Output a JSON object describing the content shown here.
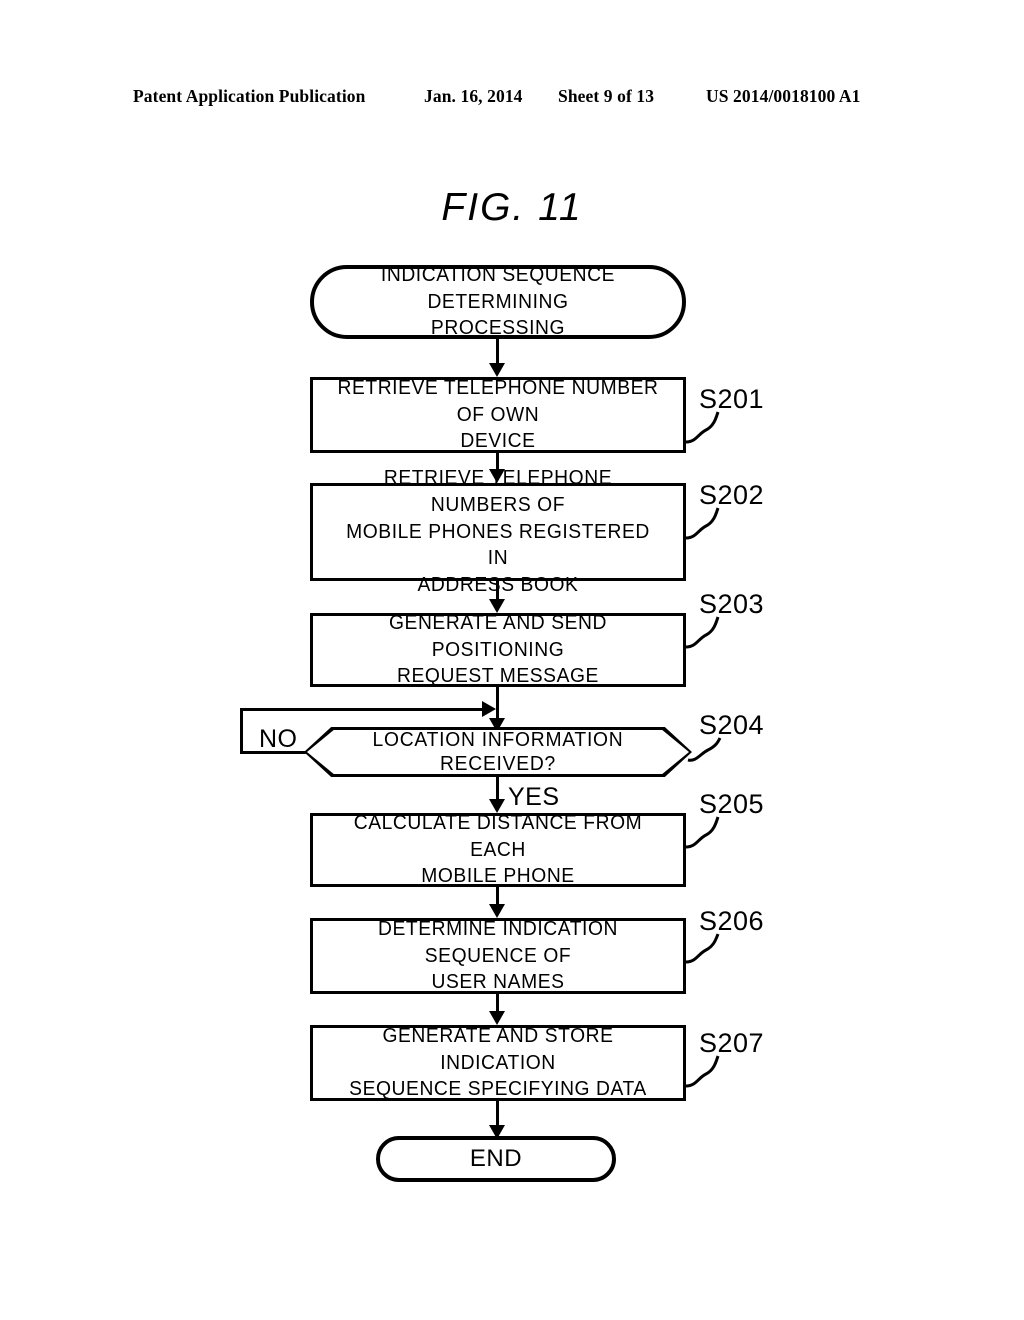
{
  "header": {
    "publication": "Patent Application Publication",
    "date": "Jan. 16, 2014",
    "sheet": "Sheet 9 of 13",
    "patent_number": "US 2014/0018100 A1"
  },
  "figure": {
    "title": "FIG. 11"
  },
  "chart_data": {
    "type": "diagram",
    "diagram_kind": "flowchart",
    "title": "FIG. 11",
    "nodes": [
      {
        "id": "start",
        "shape": "terminator",
        "text": "INDICATION SEQUENCE DETERMINING PROCESSING",
        "lines": [
          "INDICATION SEQUENCE DETERMINING",
          "PROCESSING"
        ],
        "step": ""
      },
      {
        "id": "s201",
        "shape": "process",
        "text": "RETRIEVE TELEPHONE NUMBER OF OWN DEVICE",
        "lines": [
          "RETRIEVE TELEPHONE NUMBER OF OWN",
          "DEVICE"
        ],
        "step": "S201"
      },
      {
        "id": "s202",
        "shape": "process",
        "text": "RETRIEVE TELEPHONE NUMBERS OF MOBILE PHONES REGISTERED IN ADDRESS BOOK",
        "lines": [
          "RETRIEVE TELEPHONE NUMBERS OF",
          "MOBILE PHONES REGISTERED IN",
          "ADDRESS BOOK"
        ],
        "step": "S202"
      },
      {
        "id": "s203",
        "shape": "process",
        "text": "GENERATE AND SEND POSITIONING REQUEST MESSAGE",
        "lines": [
          "GENERATE AND SEND POSITIONING",
          "REQUEST MESSAGE"
        ],
        "step": "S203"
      },
      {
        "id": "s204",
        "shape": "decision",
        "text": "LOCATION INFORMATION RECEIVED?",
        "lines": [
          "LOCATION INFORMATION RECEIVED?"
        ],
        "step": "S204",
        "branches": [
          "NO",
          "YES"
        ]
      },
      {
        "id": "s205",
        "shape": "process",
        "text": "CALCULATE DISTANCE FROM EACH MOBILE PHONE",
        "lines": [
          "CALCULATE DISTANCE FROM EACH",
          "MOBILE PHONE"
        ],
        "step": "S205"
      },
      {
        "id": "s206",
        "shape": "process",
        "text": "DETERMINE INDICATION SEQUENCE OF USER NAMES",
        "lines": [
          "DETERMINE INDICATION SEQUENCE OF",
          "USER NAMES"
        ],
        "step": "S206"
      },
      {
        "id": "s207",
        "shape": "process",
        "text": "GENERATE AND STORE INDICATION SEQUENCE SPECIFYING DATA",
        "lines": [
          "GENERATE AND STORE INDICATION",
          "SEQUENCE SPECIFYING DATA"
        ],
        "step": "S207"
      },
      {
        "id": "end",
        "shape": "terminator",
        "text": "END",
        "lines": [
          "END"
        ],
        "step": ""
      }
    ],
    "edges": [
      {
        "from": "start",
        "to": "s201",
        "label": ""
      },
      {
        "from": "s201",
        "to": "s202",
        "label": ""
      },
      {
        "from": "s202",
        "to": "s203",
        "label": ""
      },
      {
        "from": "s203",
        "to": "s204",
        "label": ""
      },
      {
        "from": "s204",
        "to": "s205",
        "label": "YES"
      },
      {
        "from": "s204",
        "to": "s204",
        "label": "NO"
      },
      {
        "from": "s205",
        "to": "s206",
        "label": ""
      },
      {
        "from": "s206",
        "to": "s207",
        "label": ""
      },
      {
        "from": "s207",
        "to": "end",
        "label": ""
      }
    ]
  },
  "nodes": {
    "start": {
      "line1": "INDICATION SEQUENCE DETERMINING",
      "line2": "PROCESSING"
    },
    "s201": {
      "line1": "RETRIEVE TELEPHONE NUMBER OF OWN",
      "line2": "DEVICE",
      "step": "S201"
    },
    "s202": {
      "line1": "RETRIEVE TELEPHONE NUMBERS OF",
      "line2": "MOBILE PHONES REGISTERED IN",
      "line3": "ADDRESS BOOK",
      "step": "S202"
    },
    "s203": {
      "line1": "GENERATE AND SEND POSITIONING",
      "line2": "REQUEST MESSAGE",
      "step": "S203"
    },
    "s204": {
      "line1": "LOCATION INFORMATION RECEIVED?",
      "step": "S204",
      "no_label": "NO",
      "yes_label": "YES"
    },
    "s205": {
      "line1": "CALCULATE DISTANCE FROM EACH",
      "line2": "MOBILE PHONE",
      "step": "S205"
    },
    "s206": {
      "line1": "DETERMINE INDICATION SEQUENCE OF",
      "line2": "USER NAMES",
      "step": "S206"
    },
    "s207": {
      "line1": "GENERATE AND STORE INDICATION",
      "line2": "SEQUENCE SPECIFYING DATA",
      "step": "S207"
    },
    "end": {
      "line1": "END"
    }
  }
}
